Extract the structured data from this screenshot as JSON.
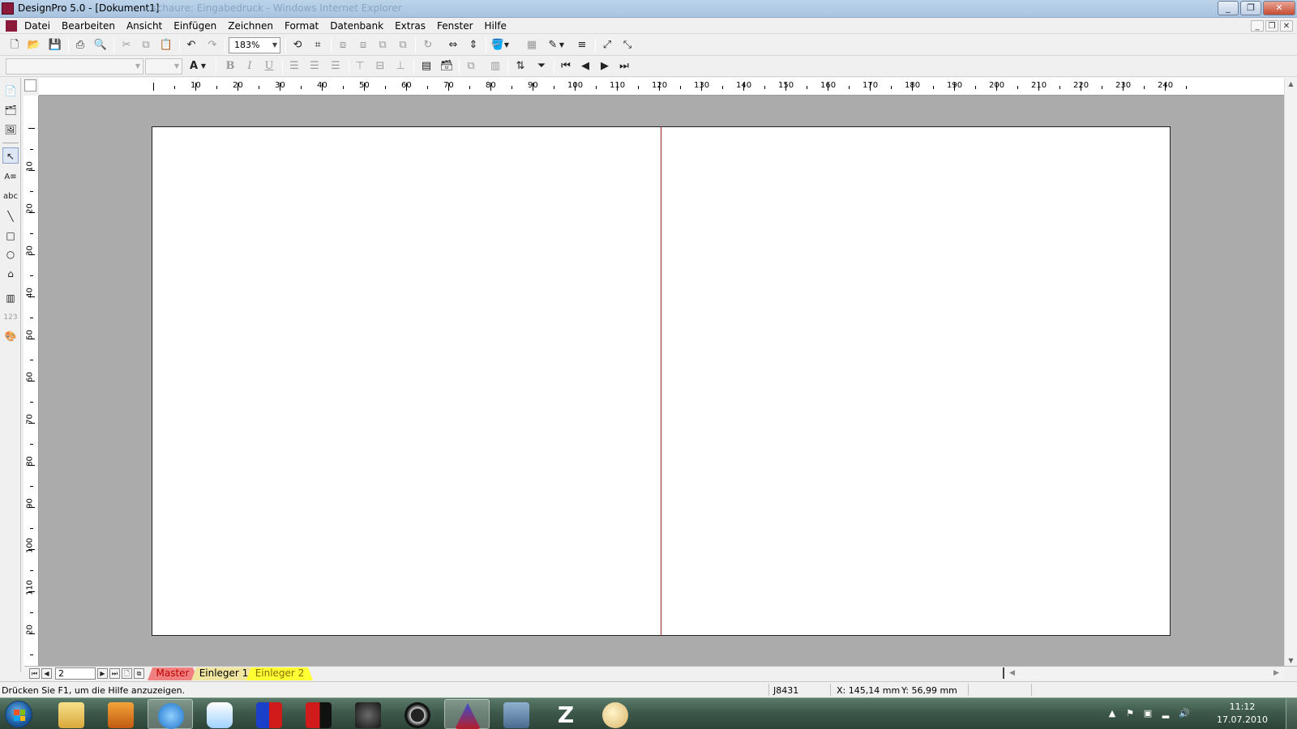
{
  "window": {
    "title": "DesignPro 5.0 - [Dokument1]",
    "background_title": "...schaure: Eingabedruck - Windows Internet Explorer",
    "controls": {
      "minimize": "_",
      "restore": "❐",
      "close": "✕"
    },
    "doc_controls": {
      "minimize": "_",
      "restore": "❐",
      "close": "✕"
    }
  },
  "menu": [
    "Datei",
    "Bearbeiten",
    "Ansicht",
    "Einfügen",
    "Zeichnen",
    "Format",
    "Datenbank",
    "Extras",
    "Fenster",
    "Hilfe"
  ],
  "toolbar1": {
    "zoom_value": "183%"
  },
  "toolbar2": {
    "font_name": "",
    "font_size": "",
    "bold": "B",
    "italic": "I",
    "underline": "U",
    "font_color": "A"
  },
  "rulers": {
    "horizontal_labels": [
      "10",
      "20",
      "30",
      "40",
      "50",
      "60",
      "70",
      "80",
      "90",
      "100",
      "110",
      "120",
      "130",
      "140",
      "150",
      "160",
      "170",
      "180",
      "190",
      "200",
      "210",
      "220",
      "230",
      "240"
    ],
    "vertical_labels": [
      "10",
      "20",
      "30",
      "40",
      "50",
      "60",
      "70",
      "80",
      "90",
      "100",
      "110",
      "20"
    ]
  },
  "page_nav": {
    "current_page": "2",
    "tabs": [
      {
        "label": "Master",
        "bg": "#f08080",
        "color": "#c00000"
      },
      {
        "label": "Einleger 1",
        "bg": "#f0e6a0",
        "color": "#000000"
      },
      {
        "label": "Einleger 2",
        "bg": "#ffff33",
        "color": "#8a6d00"
      }
    ]
  },
  "status": {
    "help_text": "Drücken Sie F1, um die Hilfe anzuzeigen.",
    "product_code": "J8431",
    "x_coord": "X: 145,14 mm",
    "y_coord": "Y: 56,99 mm"
  },
  "taskbar": {
    "apps": [
      "windows-explorer",
      "media-player",
      "internet-explorer",
      "teamviewer",
      "app-b-blue",
      "app-b-red",
      "app-s",
      "camera-app",
      "designpro",
      "user-app",
      "zend-app",
      "paint-app"
    ],
    "active_app": "designpro",
    "time": "11:12",
    "date": "17.07.2010"
  },
  "colors": {
    "canvas_bg": "#ababab",
    "fold_line": "#9c2424",
    "titlebar": "#bcd3ea"
  }
}
